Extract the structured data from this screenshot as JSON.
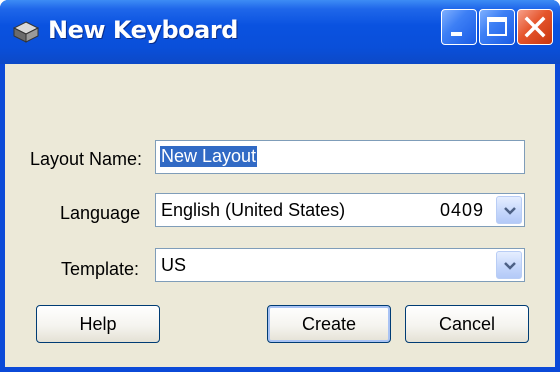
{
  "window": {
    "title": "New Keyboard"
  },
  "form": {
    "layout_name": {
      "label": "Layout Name:",
      "value": "New Layout"
    },
    "language": {
      "label": "Language",
      "value": "English (United States)",
      "code": "0409"
    },
    "template": {
      "label": "Template:",
      "value": "US"
    }
  },
  "buttons": {
    "help": "Help",
    "create": "Create",
    "cancel": "Cancel"
  },
  "colors": {
    "titlebar": "#0a52e0",
    "client": "#ece9d8",
    "selection": "#316ac5",
    "close_button": "#e5552c"
  },
  "icons": {
    "app": "keyboard-app-icon",
    "minimize": "minimize-icon",
    "maximize": "maximize-icon",
    "close": "close-icon",
    "dropdown": "chevron-down-icon"
  }
}
